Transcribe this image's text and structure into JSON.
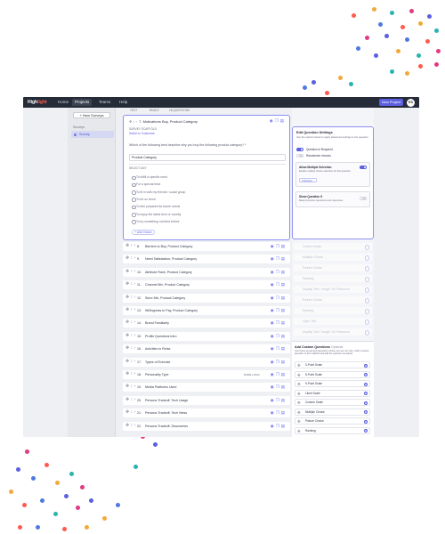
{
  "topbar": {
    "logo_main": "High",
    "logo_accent": "light",
    "nav": [
      "Home",
      "Projects",
      "Teams",
      "Help"
    ],
    "active_nav": "Projects",
    "new_project_label": "New Project",
    "avatar_initials": "ES"
  },
  "sidebar": {
    "new_survey_label": "+ New Surveys",
    "group_label": "Surveys",
    "item_label": "Survey"
  },
  "subbar": {
    "tab": "TEST",
    "count": "READY",
    "questions": "18 QUESTIONS"
  },
  "active_question": {
    "number": "7.",
    "title": "Motivations Buy, Product Category",
    "type_label": "SURVEY SCAFFOLD",
    "link_label": "Switch to Customize",
    "question_text": "Which of the following best describe why you buy the following product category? *",
    "answer_value": "Product Category",
    "select_label": "SELECT ANY",
    "options": [
      "To fulfill a specific need",
      "For a special treat",
      "To fit in with my friends / social group",
      "To be on trend",
      "To feel prepared for future needs",
      "To enjoy the latest tech or novelty",
      "To try something not tried before"
    ],
    "add_choice_label": "+ Add Choice"
  },
  "questions": [
    {
      "num": "8.",
      "label": "Barriers to Buy, Product Category",
      "badge": ""
    },
    {
      "num": "9.",
      "label": "Need Satisfaction, Product Category",
      "badge": ""
    },
    {
      "num": "10.",
      "label": "Attribute Rank, Product Category",
      "badge": ""
    },
    {
      "num": "11.",
      "label": "Channel Mix, Product Category",
      "badge": ""
    },
    {
      "num": "12.",
      "label": "Store Mix, Product Category",
      "badge": ""
    },
    {
      "num": "13.",
      "label": "Willingness to Pay, Product Category",
      "badge": ""
    },
    {
      "num": "14.",
      "label": "Brand Familiarity",
      "badge": ""
    },
    {
      "num": "15.",
      "label": "Profile Questions Intro",
      "badge": ""
    },
    {
      "num": "16.",
      "label": "Activities to Relax",
      "badge": ""
    },
    {
      "num": "17.",
      "label": "Types of Exercise",
      "badge": ""
    },
    {
      "num": "18.",
      "label": "Personality Type",
      "badge": "MORE LOGIC"
    },
    {
      "num": "19.",
      "label": "Media Platforms Used",
      "badge": ""
    },
    {
      "num": "20.",
      "label": "Persona Tradeoff, Tech Usage",
      "badge": ""
    },
    {
      "num": "21.",
      "label": "Persona Tradeoff, Tech News",
      "badge": ""
    },
    {
      "num": "22.",
      "label": "Persona Tradeoff, Discoveries",
      "badge": ""
    }
  ],
  "settings": {
    "title": "Edit Question Settings",
    "desc": "Use the options below to apply advanced settings to the question.",
    "toggle1": "Question is Required",
    "toggle2": "Randomize choices",
    "multi_title": "Allow Multiple Selection",
    "multi_desc": "Enable multiple choice selection for this question",
    "multi_value": "Unlimited",
    "show_title": "Show Question if",
    "show_desc": "Based previous questions and responses"
  },
  "ghost_items": [
    "Custom Scale",
    "Multiple Choice",
    "Picture Choice",
    "Ranking",
    "Display Text / Image / AV Resource",
    "Picture Choice",
    "Ranking",
    "Open Text",
    "Display Text / Image / AV Resource"
  ],
  "add_custom": {
    "title": "Add Custom Questions",
    "optional": "Optional",
    "desc": "Use these as general questions where you are not sure. Add a custom question to the scaffold and add the question as asked.",
    "items": [
      "3-Point Scale",
      "5-Point Scale",
      "9-Point Scale",
      "Likert Scale",
      "Custom Scale",
      "Multiple Choice",
      "Picture Choice",
      "Ranking"
    ]
  },
  "colors": {
    "brand": "#5b5fe0",
    "logo_accent": "#ff5a4e",
    "topbar": "#262b38"
  }
}
